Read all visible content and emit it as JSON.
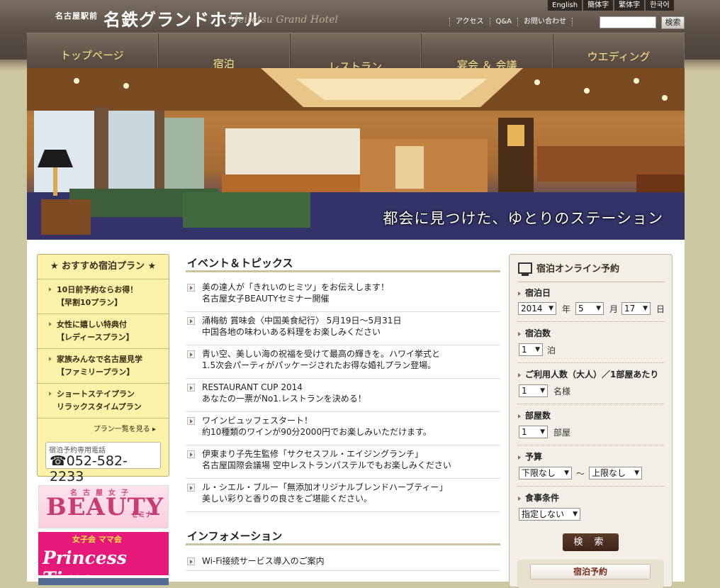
{
  "header": {
    "brand_small": "名古屋駅前",
    "brand_main": "名鉄グランドホテル",
    "brand_en": "Meitetsu Grand Hotel",
    "languages": [
      "English",
      "簡体字",
      "繁体字",
      "한국어"
    ],
    "util_links": [
      "アクセス",
      "Q&A",
      "お問い合わせ"
    ],
    "search_placeholder": "",
    "search_button": "検索"
  },
  "nav": [
    "トップページ",
    "宿泊",
    "レストラン",
    "宴会 ＆ 会議",
    "ウエディング"
  ],
  "hero": {
    "caption": "都会に見つけた、ゆとりのステーション"
  },
  "plans": {
    "title": "★ おすすめ宿泊プラン ★",
    "items": [
      {
        "line1": "10日前予約ならお得！",
        "line2": "【早割10プラン】"
      },
      {
        "line1": "女性に嬉しい特典付",
        "line2": "【レディースプラン】"
      },
      {
        "line1": "家族みんなで名古屋見学",
        "line2": "【ファミリープラン】"
      },
      {
        "line1": "ショートステイプラン",
        "line2": "リラックスタイムプラン"
      }
    ],
    "more": "プラン一覧を見る",
    "phone_label": "宿泊予約専用電話",
    "phone_number": "☎052-582-2233"
  },
  "banners": {
    "beauty_sub": "名古屋女子",
    "beauty_main": "BEAUTY",
    "beauty_tail": "セミナー",
    "princess_sub": "女子会 ママ会",
    "princess_main": "Princess Time"
  },
  "events": {
    "title": "イベント＆トピックス",
    "items": [
      {
        "line1": "美の達人が「きれいのヒミツ」をお伝えします！",
        "line2": "名古屋女子BEAUTYセミナー開催"
      },
      {
        "line1": "涌梅舫 賞味会〈中国美食紀行〉 5月19日～5月31日",
        "line2": "中国各地の味わいある料理をお楽しみください"
      },
      {
        "line1": "青い空、美しい海の祝福を受けて最高の輝きを。ハワイ挙式と",
        "line2": "1.5次会パーティがパッケージされたお得な婚礼プラン登場。"
      },
      {
        "line1": "RESTAURANT CUP 2014",
        "line2": "あなたの一票がNo1.レストランを決める！"
      },
      {
        "line1": "ワインビュッフェスタート！",
        "line2": "約10種類のワインが90分2000円でお楽しみいただけます。"
      },
      {
        "line1": "伊東まり子先生監修「サクセスフル・エイジングランチ」",
        "line2": "名古屋国際会議場 空中レストランパステルでもお楽しみください"
      },
      {
        "line1": "ル・シエル・ブルー「無添加オリジナルブレンドハーブティー」",
        "line2": "美しい彩りと香りの良さをご堪能ください。"
      }
    ]
  },
  "info": {
    "title": "インフォメーション",
    "items": [
      "Wi-Fi接続サービス導入のご案内"
    ]
  },
  "booking": {
    "title": "宿泊オンライン予約",
    "date_label": "宿泊日",
    "year": "2014",
    "year_unit": "年",
    "month": "5",
    "month_unit": "月",
    "day": "17",
    "day_unit": "日",
    "nights_label": "宿泊数",
    "nights": "1",
    "nights_unit": "泊",
    "guests_label": "ご利用人数（大人）／1部屋あたり",
    "guests": "1",
    "guests_unit": "名様",
    "rooms_label": "部屋数",
    "rooms": "1",
    "rooms_unit": "部屋",
    "budget_label": "予算",
    "budget_min": "下限なし",
    "budget_sep": "～",
    "budget_max": "上限なし",
    "meal_label": "食事条件",
    "meal": "指定しない",
    "search_button": "検 索",
    "reserve_button": "宿泊予約"
  }
}
